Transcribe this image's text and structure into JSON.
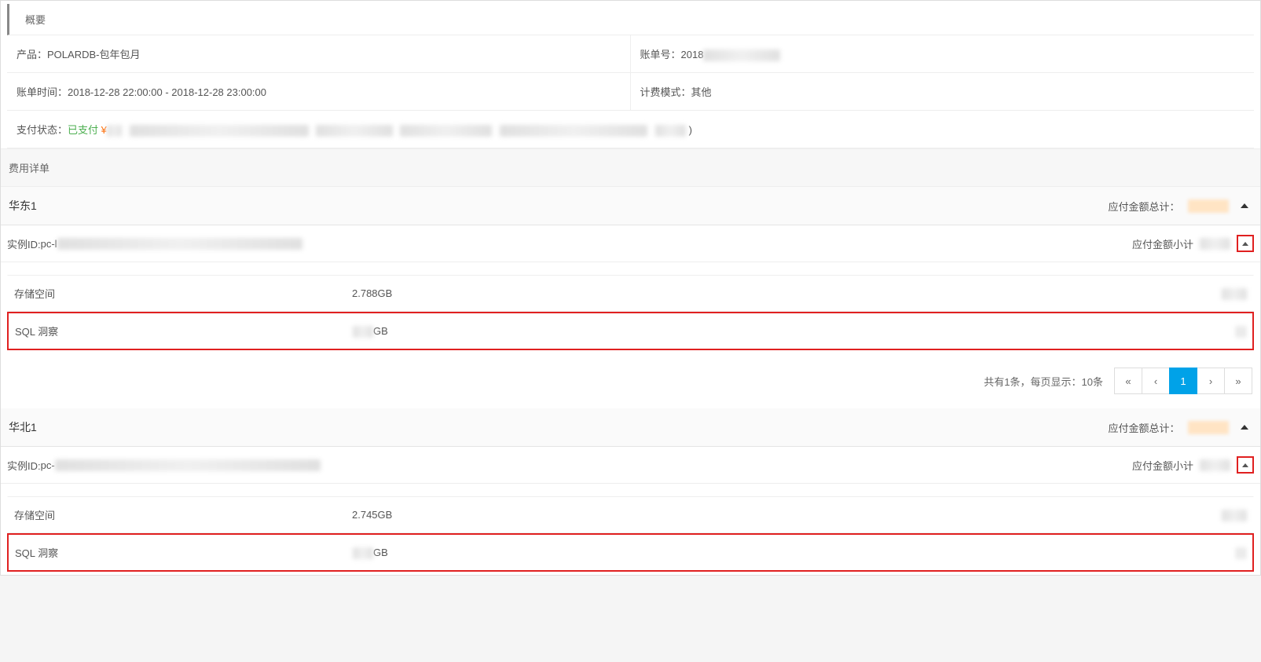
{
  "summary": {
    "header": "概要",
    "product_label": "产品：",
    "product_value": "POLARDB-包年包月",
    "bill_no_label": "账单号：",
    "bill_no_value": "2018",
    "bill_time_label": "账单时间：",
    "bill_time_value": "2018-12-28 22:00:00 -  2018-12-28 23:00:00",
    "billing_mode_label": "计费模式：",
    "billing_mode_value": "其他",
    "pay_status_label": "支付状态：",
    "pay_status_value": "已支付",
    "pay_amount_prefix": "¥",
    "pay_detail_suffix": ")"
  },
  "details_section_title": "费用详单",
  "regions": [
    {
      "name": "华东1",
      "total_label": "应付金额总计：",
      "instance_id_label": "实例ID:",
      "instance_id_prefix": "pc-l",
      "subtotal_label": "应付金额小计",
      "rows": [
        {
          "name": "存储空间",
          "usage": "2.788GB",
          "amount_redacted": true
        },
        {
          "name": "SQL 洞察",
          "usage_suffix": "GB",
          "amount_redacted": true,
          "highlighted": true
        }
      ],
      "pagination": {
        "info": "共有1条，每页显示：10条",
        "current": "1"
      }
    },
    {
      "name": "华北1",
      "total_label": "应付金额总计：",
      "instance_id_label": "实例ID:",
      "instance_id_prefix": "pc-",
      "subtotal_label": "应付金额小计",
      "rows": [
        {
          "name": "存储空间",
          "usage": "2.745GB",
          "amount_redacted": true
        },
        {
          "name": "SQL 洞察",
          "usage_suffix": "GB",
          "amount_redacted": true,
          "highlighted": true
        }
      ]
    }
  ],
  "paginator": {
    "first": "«",
    "prev": "‹",
    "next": "›",
    "last": "»"
  }
}
